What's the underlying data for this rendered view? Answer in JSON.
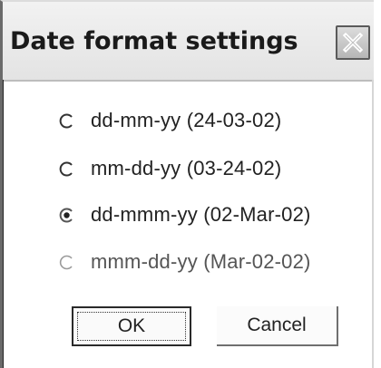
{
  "dialog": {
    "title": "Date format settings",
    "close_icon": "close-icon"
  },
  "options": [
    {
      "label": "dd-mm-yy (24-03-02)",
      "selected": false
    },
    {
      "label": "mm-dd-yy (03-24-02)",
      "selected": false
    },
    {
      "label": "dd-mmm-yy (02-Mar-02)",
      "selected": true
    },
    {
      "label": "mmm-dd-yy (Mar-02-02)",
      "selected": false
    }
  ],
  "buttons": {
    "ok_label": "OK",
    "cancel_label": "Cancel"
  },
  "colors": {
    "title_text": "#1a1a1a",
    "body_text": "#222222",
    "background": "#ffffff"
  }
}
